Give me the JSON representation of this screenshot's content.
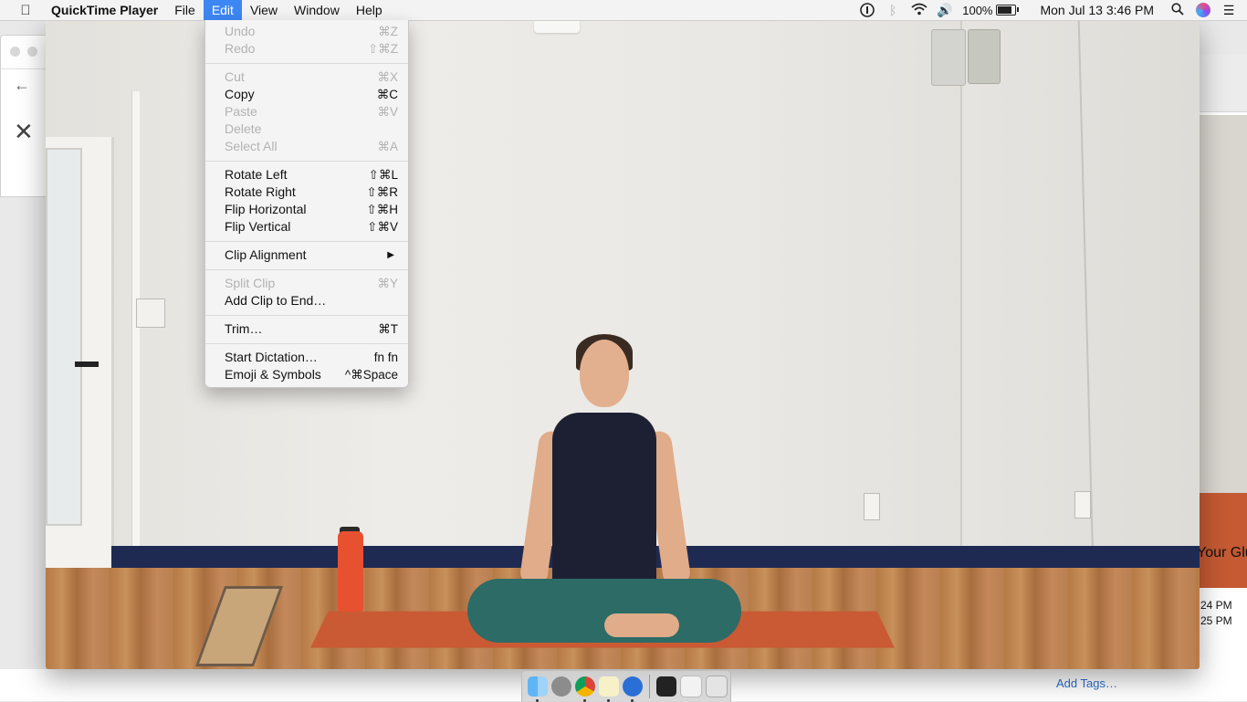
{
  "menubar": {
    "app_name": "QuickTime Player",
    "menus": [
      "File",
      "Edit",
      "View",
      "Window",
      "Help"
    ],
    "active_menu": "Edit",
    "battery_percent": "100%",
    "clock": "Mon Jul 13  3:46 PM",
    "status_icons": [
      "onepassword-icon",
      "bluetooth-icon",
      "wifi-icon",
      "volume-icon",
      "battery-charging-icon",
      "spotlight-search-icon",
      "siri-icon",
      "notification-center-icon"
    ]
  },
  "edit_menu": {
    "items": [
      {
        "label": "Undo",
        "shortcut": "⌘Z",
        "enabled": false
      },
      {
        "label": "Redo",
        "shortcut": "⇧⌘Z",
        "enabled": false
      },
      {
        "label": "Cut",
        "shortcut": "⌘X",
        "enabled": false
      },
      {
        "label": "Copy",
        "shortcut": "⌘C",
        "enabled": true
      },
      {
        "label": "Paste",
        "shortcut": "⌘V",
        "enabled": false
      },
      {
        "label": "Delete",
        "shortcut": "",
        "enabled": false
      },
      {
        "label": "Select All",
        "shortcut": "⌘A",
        "enabled": false
      },
      {
        "label": "Rotate Left",
        "shortcut": "⇧⌘L",
        "enabled": true
      },
      {
        "label": "Rotate Right",
        "shortcut": "⇧⌘R",
        "enabled": true
      },
      {
        "label": "Flip Horizontal",
        "shortcut": "⇧⌘H",
        "enabled": true
      },
      {
        "label": "Flip Vertical",
        "shortcut": "⇧⌘V",
        "enabled": true
      },
      {
        "label": "Clip Alignment",
        "shortcut": "",
        "enabled": true,
        "submenu": true
      },
      {
        "label": "Split Clip",
        "shortcut": "⌘Y",
        "enabled": false
      },
      {
        "label": "Add Clip to End…",
        "shortcut": "",
        "enabled": true
      },
      {
        "label": "Trim…",
        "shortcut": "⌘T",
        "enabled": true
      },
      {
        "label": "Start Dictation…",
        "shortcut": "fn fn",
        "enabled": true
      },
      {
        "label": "Emoji & Symbols",
        "shortcut": "^⌘Space",
        "enabled": true
      }
    ]
  },
  "background_window": {
    "title_fragment": "Your Glu",
    "time_1": "24 PM",
    "time_2": "25 PM",
    "add_tags": "Add Tags…"
  },
  "dock": {
    "apps": [
      "finder-icon",
      "launchpad-icon",
      "chrome-icon",
      "notes-icon",
      "quicktime-icon",
      "terminal-icon",
      "preview-icon",
      "trash-icon"
    ]
  },
  "colors": {
    "menu_highlight": "#3d87f5",
    "disabled_text": "#b2b2b2",
    "link_blue": "#2e6fcf"
  }
}
